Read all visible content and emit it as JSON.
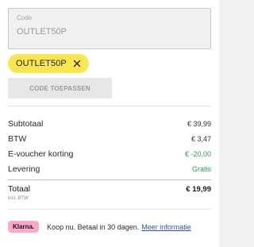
{
  "voucher": {
    "field_label": "Code",
    "field_value": "OUTLET50P",
    "applied_code": "OUTLET50P",
    "apply_button_label": "CODE TOEPASSEN"
  },
  "summary": {
    "rows": [
      {
        "label": "Subtotaal",
        "value": "€ 39,99"
      },
      {
        "label": "BTW",
        "value": "€ 3,47"
      },
      {
        "label": "E-voucher korting",
        "value": "€ -20,00"
      },
      {
        "label": "Levering",
        "value": "Gratis"
      }
    ],
    "total_label": "Totaal",
    "total_sub": "incl. BTW",
    "total_value": "€ 19,99"
  },
  "klarna": {
    "badge": "Klarna.",
    "text": "Koop nu. Betaal in 30 dagen.",
    "link": "Meer informatie"
  },
  "colors": {
    "chip": "#fbe651",
    "discount_green": "#2e9c55",
    "klarna_pink": "#ffa8cd",
    "link_blue": "#2f55a4"
  },
  "icons": {
    "chip_remove": "close-icon"
  }
}
